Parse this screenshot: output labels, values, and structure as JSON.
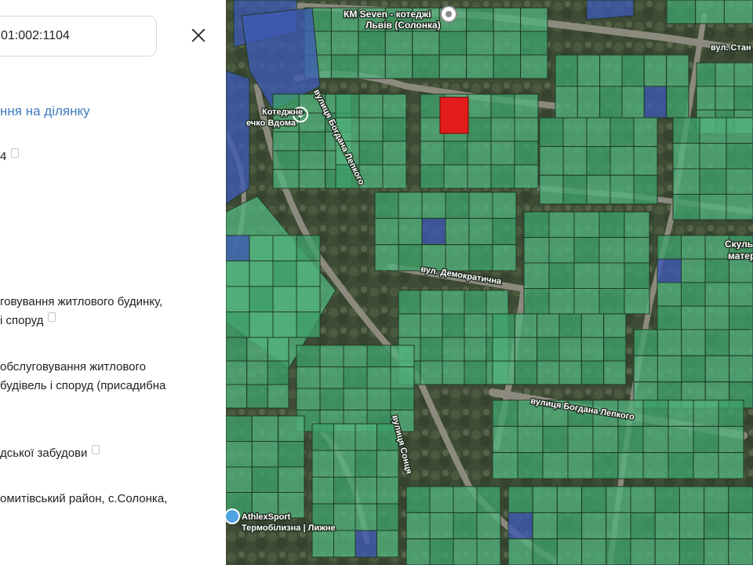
{
  "panel": {
    "search_value": "01:002:1104",
    "request_link": "ння на ділянку",
    "number_tail": "4",
    "purpose_line1": "говування житлового будинку,",
    "purpose_line2": "і споруд",
    "category_line1": "обслуговування житлового",
    "category_line2": "будівель і споруд (присадибна",
    "zone_text": "дської забудови",
    "address_line1": "омитівський район, с.Солонка,"
  },
  "map": {
    "colors": {
      "parcel": "#52b27c",
      "parcel_alt": "#3fa26a",
      "state": "#3d5ab4",
      "selected": "#e21b1b",
      "road": "#8c8a7e"
    },
    "poi": [
      {
        "name": "КМ Seven - котеджі Львів (Солонка)",
        "line1": "КМ Seven - котеджі",
        "line2": "Львів (Солонка)"
      },
      {
        "name": "Котеджне містечко Вдома",
        "line1": "Котеджне",
        "line2": "ечко Вдома"
      },
      {
        "name": "AthlexSport Термобілизна Лижне",
        "line1": "AthlexSport",
        "line2": "Термобілизна | Лижне"
      },
      {
        "name": "Скульптура матері",
        "line1": "Скульп",
        "line2": "матері"
      }
    ],
    "streets": {
      "stan": "вул. Стан",
      "bohdana_lepkoho_1": "вулиця Богдана Лепкого",
      "demokratychna": "вул. Демократична",
      "bohdana_lepkoho_2": "вулиця Богдана Лепкого",
      "sontsia": "вулиця Сонця"
    }
  }
}
